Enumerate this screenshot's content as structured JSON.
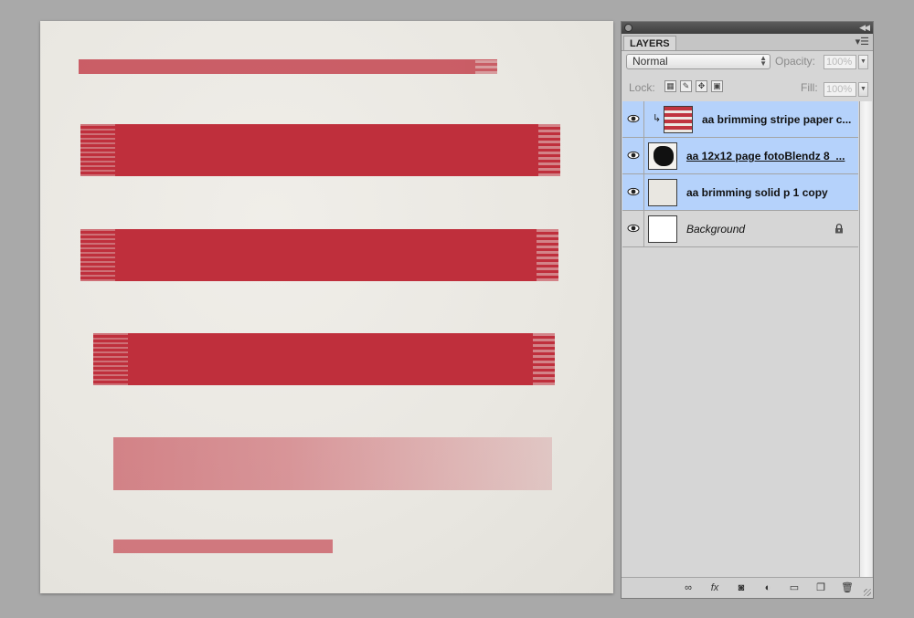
{
  "panel": {
    "tab_label": "LAYERS",
    "blend_mode": "Normal",
    "opacity_label": "Opacity:",
    "opacity_value": "100%",
    "lock_label": "Lock:",
    "fill_label": "Fill:",
    "fill_value": "100%"
  },
  "layers": [
    {
      "name": "aa brimming stripe paper c...",
      "visible": true,
      "selected": true,
      "clipped": true,
      "thumbnail": "stripes"
    },
    {
      "name": "aa 12x12 page fotoBlendz 8_...",
      "visible": true,
      "selected": true,
      "clipped": false,
      "thumbnail": "mask"
    },
    {
      "name": "aa brimming solid p 1 copy",
      "visible": true,
      "selected": true,
      "clipped": false,
      "thumbnail": "solid"
    },
    {
      "name": "Background",
      "visible": true,
      "selected": false,
      "clipped": false,
      "thumbnail": "white",
      "locked": true
    }
  ],
  "footer_icons": [
    "link-layers-icon",
    "fx-icon",
    "layer-mask-icon",
    "adjustment-layer-icon",
    "new-group-icon",
    "new-layer-icon",
    "trash-icon"
  ],
  "colors": {
    "stripe_red": "#bf2f3c",
    "selection_blue": "#b5d2fb",
    "panel_bg": "#d6d6d6",
    "workspace_gray": "#a9a9a9"
  }
}
